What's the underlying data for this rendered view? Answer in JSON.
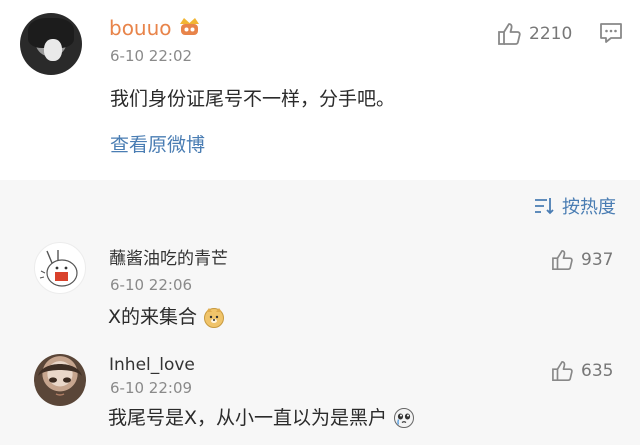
{
  "post": {
    "username": "bouuo",
    "time": "6-10 22:02",
    "text": "我们身份证尾号不一样，分手吧。",
    "view_original": "查看原微博",
    "likes": "2210",
    "icons": {
      "vip": "vip-badge-icon",
      "like": "thumbs-up-icon",
      "comment": "comment-icon"
    }
  },
  "sort": {
    "label": "按热度",
    "icon": "sort-icon"
  },
  "comments": [
    {
      "name": "蘸酱油吃的青芒",
      "time": "6-10 22:06",
      "text": "X的来集合",
      "likes": "937",
      "emoji": "doge-emoji"
    },
    {
      "name": "Inhel_love",
      "time": "6-10 22:09",
      "text": "我尾号是X，从小一直以为是黑户",
      "likes": "635",
      "emoji": "crying-emoji"
    }
  ],
  "colors": {
    "username": "#e8844a",
    "link": "#4a7db3",
    "text": "#2b2b2b",
    "meta": "#8a8a8a",
    "background": "#f7f7f7"
  }
}
